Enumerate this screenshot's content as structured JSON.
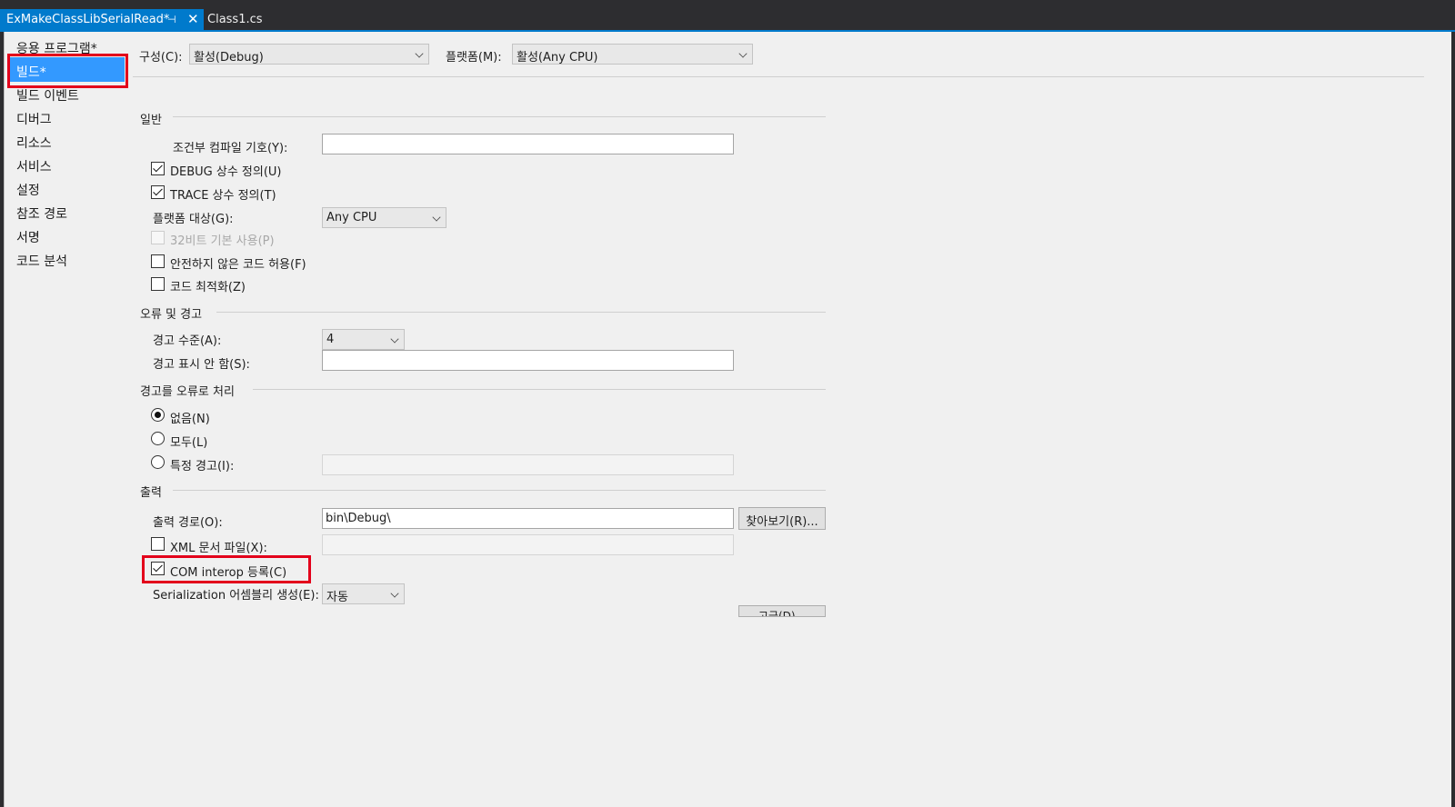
{
  "tabs": {
    "active": "ExMakeClassLibSerialRead*",
    "active_pin": "⊣",
    "active_close": "✕",
    "inactive": "Class1.cs"
  },
  "nav": {
    "items": [
      "응용 프로그램*",
      "빌드*",
      "빌드 이벤트",
      "디버그",
      "리소스",
      "서비스",
      "설정",
      "참조 경로",
      "서명",
      "코드 분석"
    ],
    "selected": "빌드*"
  },
  "config": {
    "config_label": "구성(C):",
    "config_value": "활성(Debug)",
    "platform_label": "플랫폼(M):",
    "platform_value": "활성(Any CPU)"
  },
  "general": {
    "title": "일반",
    "cond_symbols_label": "조건부 컴파일 기호(Y):",
    "cond_symbols_value": "",
    "debug_const": "DEBUG 상수 정의(U)",
    "trace_const": "TRACE 상수 정의(T)",
    "platform_target_label": "플랫폼 대상(G):",
    "platform_target_value": "Any CPU",
    "prefer32": "32비트 기본 사용(P)",
    "unsafe": "안전하지 않은 코드 허용(F)",
    "optimize": "코드 최적화(Z)"
  },
  "errors": {
    "title": "오류 및 경고",
    "warning_level_label": "경고 수준(A):",
    "warning_level_value": "4",
    "suppress_label": "경고 표시 안 함(S):",
    "suppress_value": ""
  },
  "treat": {
    "title": "경고를 오류로 처리",
    "none": "없음(N)",
    "all": "모두(L)",
    "specific": "특정 경고(I):"
  },
  "output": {
    "title": "출력",
    "path_label": "출력 경로(O):",
    "path_value": "bin\\Debug\\",
    "browse": "찾아보기(R)...",
    "xml_doc": "XML 문서 파일(X):",
    "com_interop": "COM interop 등록(C)",
    "serialization_label": "Serialization 어셈블리 생성(E):",
    "serialization_value": "자동",
    "advanced": "고급(D)..."
  },
  "colors": {
    "accent": "#007acc",
    "highlight": "#e3001b",
    "nav_selected": "#3399ff"
  }
}
